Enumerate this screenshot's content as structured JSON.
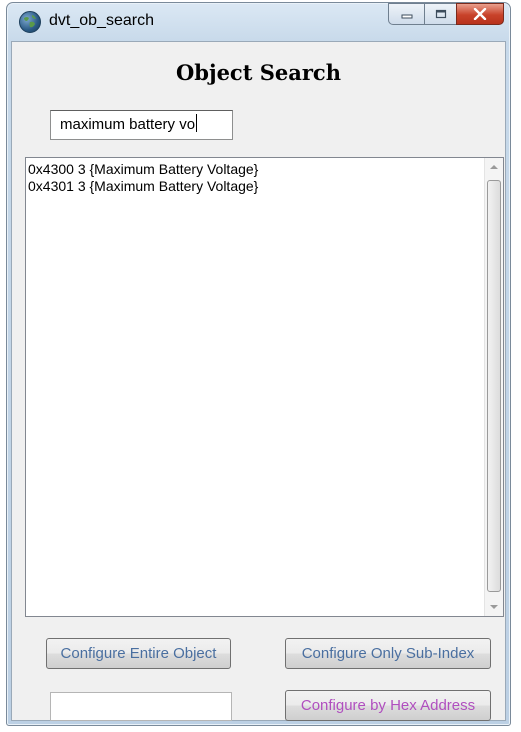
{
  "window": {
    "title": "dvt_ob_search"
  },
  "heading": "Object Search",
  "search": {
    "value": "maximum battery vo"
  },
  "results": [
    "0x4300 3 {Maximum Battery Voltage}",
    "0x4301 3 {Maximum Battery Voltage}"
  ],
  "buttons": {
    "configure_entire": "Configure Entire Object",
    "configure_subindex": "Configure Only Sub-Index",
    "configure_hex": "Configure by Hex Address"
  },
  "hex_input": {
    "value": ""
  },
  "colors": {
    "button_text": "#4a6fa0",
    "hex_button_text": "#b04fbf",
    "close_button": "#c8422a"
  },
  "icons": {
    "app": "globe-icon",
    "minimize": "minimize-icon",
    "maximize": "maximize-icon",
    "close": "close-icon",
    "scroll_up": "chevron-up-icon",
    "scroll_down": "chevron-down-icon"
  }
}
